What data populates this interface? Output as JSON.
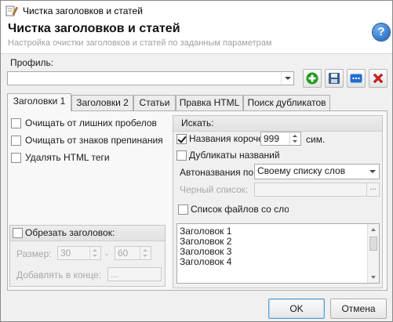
{
  "window": {
    "title": "Чистка заголовков и статей"
  },
  "header": {
    "title": "Чистка заголовков и статей",
    "subtitle": "Настройка очистки заголовков и статей по заданным параметрам"
  },
  "profile": {
    "label": "Профиль:",
    "value": ""
  },
  "tabs": [
    {
      "label": "Заголовки 1",
      "active": true
    },
    {
      "label": "Заголовки 2",
      "active": false
    },
    {
      "label": "Статьи",
      "active": false
    },
    {
      "label": "Правка HTML",
      "active": false
    },
    {
      "label": "Поиск дубликатов",
      "active": false
    }
  ],
  "options": {
    "trim_spaces": "Очищать от лишних пробелов",
    "remove_punct": "Очищать от знаков препинания",
    "remove_html": "Удалять HTML теги"
  },
  "trim_group": {
    "label": "Обрезать заголовок:",
    "size_label": "Размер:",
    "size_from": "30",
    "size_dash": "-",
    "size_to": "60",
    "append_label": "Добавлять в конце:",
    "append_value": "..."
  },
  "search_group": {
    "title": "Искать:",
    "short_names_label": "Названия короче",
    "short_names_checked": true,
    "short_names_value": "999",
    "short_names_unit": "сим.",
    "duplicates_label": "Дубликаты названий",
    "auto_label": "Автоназвания по:",
    "auto_value": "Своему списку слов",
    "blacklist_label": "Черный список:",
    "filelist_label": "Список файлов со слова",
    "file_items": [
      "Заголовок 1",
      "Заголовок 2",
      "Заголовок 3",
      "Заголовок 4"
    ]
  },
  "buttons": {
    "ok": "OK",
    "cancel": "Отмена"
  },
  "icons": {
    "app": "brush-app-icon",
    "help": "help-icon",
    "add": "add-icon",
    "save": "save-icon",
    "more": "ellipsis-icon",
    "delete": "delete-icon"
  },
  "colors": {
    "add": "#1f9a1f",
    "delete": "#d21f1f",
    "help": "#1c5fb5",
    "more": "#1f6fd0"
  }
}
